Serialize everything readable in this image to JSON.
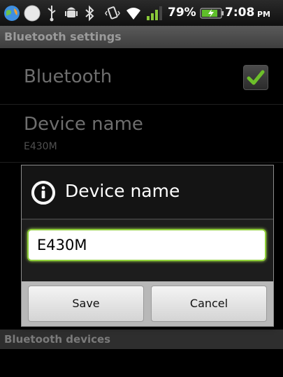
{
  "status_bar": {
    "icons": [
      "globe-icon",
      "status-circle-icon",
      "usb-icon",
      "android-debug-icon",
      "bluetooth-icon",
      "vibrate-icon",
      "wifi-icon",
      "signal-icon",
      "battery-charging-icon"
    ],
    "battery_percent": "79%",
    "time": "7:08",
    "ampm": "PM"
  },
  "titlebar": {
    "title": "Bluetooth settings"
  },
  "settings": {
    "bluetooth_label": "Bluetooth",
    "device_name_label": "Device name",
    "device_name_value": "E430M",
    "bluetooth_checked": true
  },
  "section": {
    "devices_header": "Bluetooth devices"
  },
  "dialog": {
    "title": "Device name",
    "icon": "info-icon",
    "input_value": "E430M",
    "save_label": "Save",
    "cancel_label": "Cancel"
  },
  "colors": {
    "input_focus": "#8fcf3a",
    "check_green": "#6dbf2a"
  }
}
